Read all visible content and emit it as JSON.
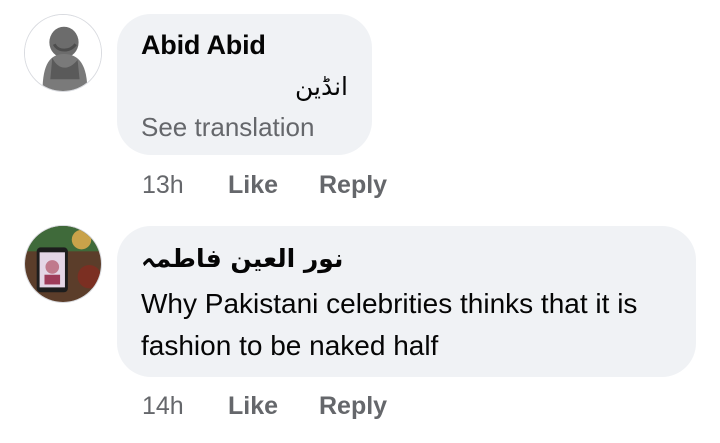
{
  "comments": [
    {
      "author": "Abid Abid",
      "text": "انڈین",
      "see_translation": "See translation",
      "time": "13h",
      "like_label": "Like",
      "reply_label": "Reply"
    },
    {
      "author": "نور العین فاطمہ",
      "text": "Why Pakistani celebrities thinks that it is fashion to be naked half",
      "time": "14h",
      "like_label": "Like",
      "reply_label": "Reply"
    }
  ],
  "colors": {
    "bubble_bg": "#f0f2f5",
    "secondary_text": "#65676b",
    "primary_text": "#050505"
  }
}
